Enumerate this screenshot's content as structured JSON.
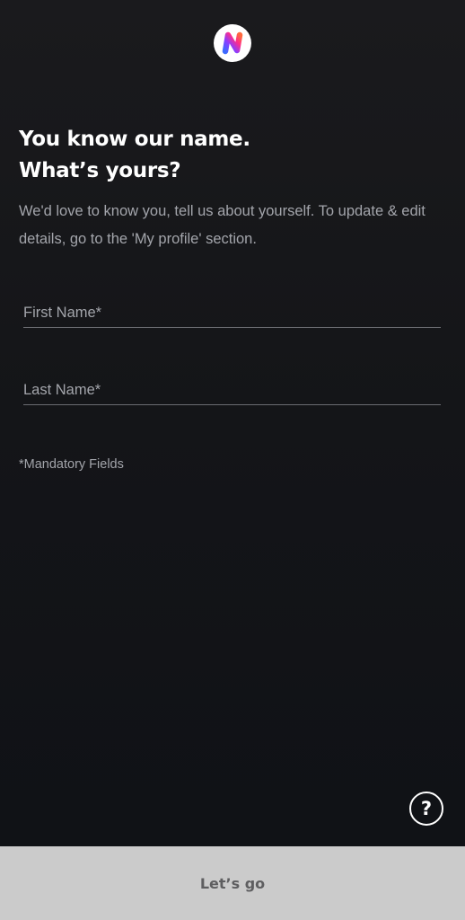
{
  "app": {
    "logo_icon": "gradient-n-logo-icon"
  },
  "header": {
    "title_line1": "You know our name.",
    "title_line2": "What’s yours?",
    "subtitle": "We'd love to know you, tell us about yourself. To update & edit details, go to the 'My profile' section."
  },
  "form": {
    "first_name": {
      "placeholder": "First Name*",
      "value": ""
    },
    "last_name": {
      "placeholder": "Last Name*",
      "value": ""
    },
    "mandatory_note": "*Mandatory Fields"
  },
  "help": {
    "label": "?",
    "icon": "help-circle-icon"
  },
  "footer": {
    "cta_label": "Let’s go"
  },
  "colors": {
    "background_top": "#1a1a1d",
    "background_bottom": "#0f1116",
    "primary_text": "#ffffff",
    "secondary_text": "#a3a5ab",
    "field_underline": "#6b6c71",
    "cta_background": "#cbcbcb",
    "cta_text": "#5e5e60",
    "logo_gradient": [
      "#ff6a3d",
      "#ff2d8a",
      "#8b3dff",
      "#3d6bff"
    ]
  }
}
